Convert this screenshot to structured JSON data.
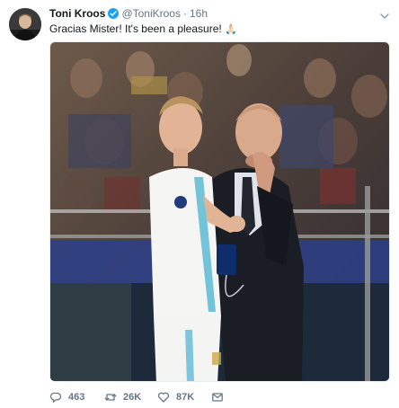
{
  "tweet": {
    "author": {
      "display_name": "Toni Kroos",
      "handle": "@ToniKroos",
      "verified": true
    },
    "separator": "·",
    "timestamp": "16h",
    "text": "Gracias Mister! It's been a pleasure!",
    "emoji": "🙏🏻",
    "media": {
      "alt_description": "photo"
    },
    "actions": {
      "replies": "463",
      "retweets": "26K",
      "likes": "87K"
    }
  },
  "colors": {
    "text_primary": "#14171a",
    "text_secondary": "#657786",
    "verified_blue": "#1da1f2"
  },
  "icons": [
    "verified-badge-icon",
    "chevron-down-icon",
    "reply-icon",
    "retweet-icon",
    "like-icon",
    "direct-message-icon"
  ]
}
